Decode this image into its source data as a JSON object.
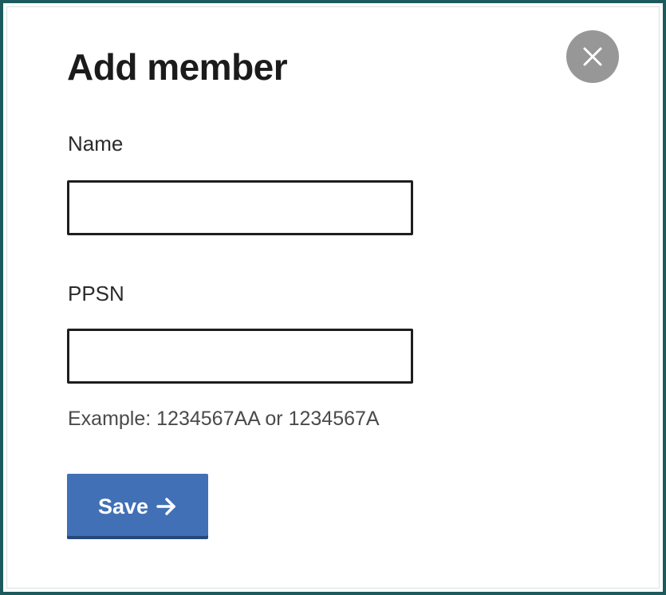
{
  "dialog": {
    "title": "Add member",
    "close_icon": "close-icon",
    "fields": {
      "name": {
        "label": "Name",
        "value": "",
        "placeholder": ""
      },
      "ppsn": {
        "label": "PPSN",
        "value": "",
        "placeholder": "",
        "hint": "Example: 1234567AA or 1234567A"
      }
    },
    "save": {
      "label": "Save",
      "icon": "arrow-right-icon"
    }
  },
  "colors": {
    "frame_border": "#1d5a5e",
    "close_button": "#979797",
    "primary_button": "#4170b6",
    "input_border": "#1e1e1e"
  }
}
